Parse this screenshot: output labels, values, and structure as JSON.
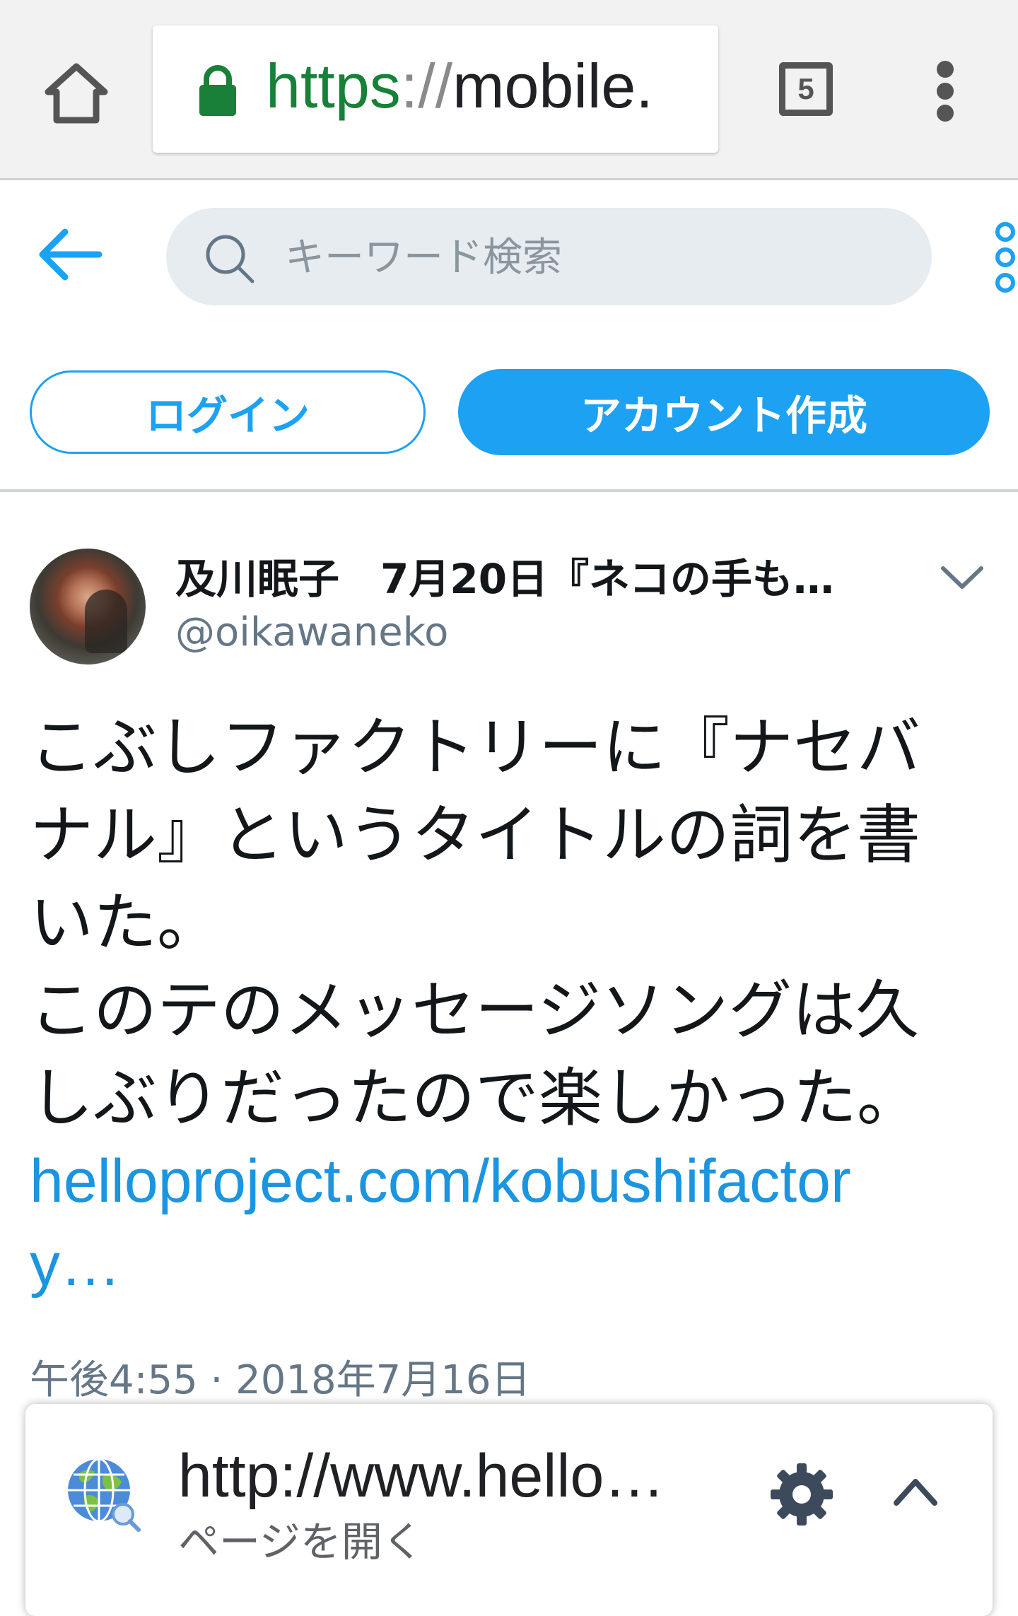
{
  "browser": {
    "url_scheme": "https",
    "url_separator": "://",
    "url_host": "mobile.",
    "tab_count": "5",
    "icons": {
      "home": "home-icon",
      "lock": "lock-icon",
      "tabs": "tab-switcher-icon",
      "menu": "overflow-menu-icon"
    },
    "colors": {
      "secure": "#188038"
    }
  },
  "header": {
    "search_placeholder": "キーワード検索",
    "login_label": "ログイン",
    "signup_label": "アカウント作成",
    "icons": {
      "back": "back-arrow-icon",
      "search": "search-icon",
      "more": "more-options-icon"
    },
    "colors": {
      "accent": "#1da1f2",
      "search_bg": "#e6ecf0"
    }
  },
  "tweet": {
    "author_name": "及川眠子　7月20日『ネコの手も…",
    "handle": "@oikawaneko",
    "text_lines": [
      "こぶしファクトリーに『ナセバ",
      "ナル』というタイトルの詞を書",
      "いた。",
      "このテのメッセージソングは久",
      "しぶりだったので楽しかった。"
    ],
    "link_lines": [
      "helloproject.com/kobushifactor",
      "y…"
    ],
    "timestamp": "午後4:55 · 2018年7月16日",
    "colors": {
      "link": "#1b95e0",
      "meta": "#657786"
    }
  },
  "link_preview_sheet": {
    "url": "http://www.hello…",
    "action_label": "ページを開く",
    "icons": {
      "site": "globe-icon",
      "settings": "gear-icon",
      "expand": "chevron-up-icon"
    }
  }
}
